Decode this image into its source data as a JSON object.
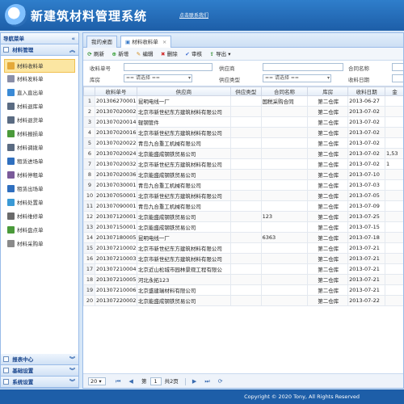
{
  "app": {
    "title": "新建筑材料管理系统",
    "contact_link": "点击联系我们"
  },
  "sidebar": {
    "header": "导航菜单",
    "group_title": "材料管理",
    "items": [
      {
        "label": "材料收料单",
        "icon": "receipt-folder-icon",
        "color": "#e4a93a",
        "active": true
      },
      {
        "label": "材料发料单",
        "icon": "issue-doc-icon",
        "color": "#8a8fa8"
      },
      {
        "label": "直入直出单",
        "icon": "direct-inout-icon",
        "color": "#3a8ad6"
      },
      {
        "label": "材料退库单",
        "icon": "return-icon",
        "color": "#5a6b82"
      },
      {
        "label": "材料退货单",
        "icon": "refund-icon",
        "color": "#5a6b82"
      },
      {
        "label": "材料报损单",
        "icon": "damage-icon",
        "color": "#4a9a3a"
      },
      {
        "label": "材料调拨单",
        "icon": "transfer-icon",
        "color": "#5a6b82"
      },
      {
        "label": "租赁进场单",
        "icon": "lease-in-icon",
        "color": "#2f6fbf"
      },
      {
        "label": "材料停租单",
        "icon": "lease-stop-icon",
        "color": "#7a5a9a"
      },
      {
        "label": "租赁出场单",
        "icon": "lease-out-icon",
        "color": "#2f6fbf"
      },
      {
        "label": "材料处置单",
        "icon": "dispose-icon",
        "color": "#3a9ad6"
      },
      {
        "label": "材料维修单",
        "icon": "repair-icon",
        "color": "#6a6a6a"
      },
      {
        "label": "材料盘点单",
        "icon": "inventory-icon",
        "color": "#4a9a3a"
      },
      {
        "label": "材料采购单",
        "icon": "purchase-icon",
        "color": "#8a8a8a"
      }
    ],
    "bottom_groups": [
      "报表中心",
      "基础设置",
      "系统设置"
    ]
  },
  "tabs": [
    {
      "label": "我的桌面"
    },
    {
      "label": "材料收料单",
      "active": true
    }
  ],
  "toolbar": {
    "refresh": "刷新",
    "add": "新增",
    "edit": "编辑",
    "delete": "删除",
    "audit": "审核",
    "export": "导出"
  },
  "filters": {
    "doc_no_label": "收料单号",
    "supplier_label": "供应商",
    "contract_label": "合同名称",
    "warehouse_label": "库房",
    "warehouse_value": "== 请选择 ==",
    "supplier_type_label": "供应类型",
    "supplier_type_value": "== 请选择 ==",
    "date_label": "收料日期"
  },
  "table": {
    "columns": [
      "收料单号",
      "供应商",
      "供应类型",
      "合同名称",
      "库房",
      "收料日期",
      "金"
    ],
    "rows": [
      {
        "n": "1",
        "no": "201306270001",
        "supplier": "昆明电线一厂",
        "type": "",
        "contract": "国税采购合同",
        "wh": "第二仓库",
        "date": "2013-06-27",
        "amt": ""
      },
      {
        "n": "2",
        "no": "201307020002",
        "supplier": "北京市新世纪东方建筑材料有限公司",
        "type": "",
        "contract": "",
        "wh": "第二仓库",
        "date": "2013-07-02",
        "amt": ""
      },
      {
        "n": "3",
        "no": "201307020014",
        "supplier": "辊钢管件",
        "type": "",
        "contract": "",
        "wh": "第二仓库",
        "date": "2013-07-02",
        "amt": ""
      },
      {
        "n": "4",
        "no": "201307020016",
        "supplier": "北京市新世纪东方建筑材料有限公司",
        "type": "",
        "contract": "",
        "wh": "第二仓库",
        "date": "2013-07-02",
        "amt": ""
      },
      {
        "n": "5",
        "no": "201307020022",
        "supplier": "青岛九合重工机械有限公司",
        "type": "",
        "contract": "",
        "wh": "第二仓库",
        "date": "2013-07-02",
        "amt": ""
      },
      {
        "n": "6",
        "no": "201307020024",
        "supplier": "北京能盛成钢铁贸易公司",
        "type": "",
        "contract": "",
        "wh": "第二仓库",
        "date": "2013-07-02",
        "amt": "1,53"
      },
      {
        "n": "7",
        "no": "201307020032",
        "supplier": "北京市新世纪东方建筑材料有限公司",
        "type": "",
        "contract": "",
        "wh": "第二仓库",
        "date": "2013-07-02",
        "amt": "1"
      },
      {
        "n": "8",
        "no": "201307020036",
        "supplier": "北京能盛成钢铁贸易公司",
        "type": "",
        "contract": "",
        "wh": "第二仓库",
        "date": "2013-07-10",
        "amt": ""
      },
      {
        "n": "9",
        "no": "201307030001",
        "supplier": "青岛九合重工机械有限公司",
        "type": "",
        "contract": "",
        "wh": "第二仓库",
        "date": "2013-07-03",
        "amt": ""
      },
      {
        "n": "10",
        "no": "201307050001",
        "supplier": "北京市新世纪东方建筑材料有限公司",
        "type": "",
        "contract": "",
        "wh": "第二仓库",
        "date": "2013-07-05",
        "amt": ""
      },
      {
        "n": "11",
        "no": "201307090001",
        "supplier": "青岛九合重工机械有限公司",
        "type": "",
        "contract": "",
        "wh": "第二仓库",
        "date": "2013-07-09",
        "amt": ""
      },
      {
        "n": "12",
        "no": "201307120001",
        "supplier": "北京能盛成钢铁贸易公司",
        "type": "",
        "contract": "123",
        "wh": "第二仓库",
        "date": "2013-07-25",
        "amt": ""
      },
      {
        "n": "13",
        "no": "201307150001",
        "supplier": "北京能盛成钢铁贸易公司",
        "type": "",
        "contract": "",
        "wh": "第二仓库",
        "date": "2013-07-15",
        "amt": ""
      },
      {
        "n": "14",
        "no": "201307180005",
        "supplier": "昆明电线一厂",
        "type": "",
        "contract": "6363",
        "wh": "第二仓库",
        "date": "2013-07-18",
        "amt": ""
      },
      {
        "n": "15",
        "no": "201307210002",
        "supplier": "北京市新世纪东方建筑材料有限公司",
        "type": "",
        "contract": "",
        "wh": "第二仓库",
        "date": "2013-07-21",
        "amt": ""
      },
      {
        "n": "16",
        "no": "201307210003",
        "supplier": "北京市新世纪东方建筑材料有限公司",
        "type": "",
        "contract": "",
        "wh": "第二仓库",
        "date": "2013-07-21",
        "amt": ""
      },
      {
        "n": "17",
        "no": "201307210004",
        "supplier": "北京近山松城市园林景观工程有限公",
        "type": "",
        "contract": "",
        "wh": "第二仓库",
        "date": "2013-07-21",
        "amt": ""
      },
      {
        "n": "18",
        "no": "201307210005",
        "supplier": "河北永拓123",
        "type": "",
        "contract": "",
        "wh": "第二仓库",
        "date": "2013-07-21",
        "amt": ""
      },
      {
        "n": "19",
        "no": "201307210006",
        "supplier": "北京盛建瑞材料有限公司",
        "type": "",
        "contract": "",
        "wh": "第二仓库",
        "date": "2013-07-21",
        "amt": ""
      },
      {
        "n": "20",
        "no": "201307220002",
        "supplier": "北京能盛成钢铁贸易公司",
        "type": "",
        "contract": "",
        "wh": "第二仓库",
        "date": "2013-07-22",
        "amt": ""
      }
    ]
  },
  "pager": {
    "page_size": "20",
    "page_prefix": "第",
    "current_page": "1",
    "page_suffix": "共2页"
  },
  "footer": {
    "copyright": "Copyright © 2020 Tony, All Rights Reserved"
  },
  "colors": {
    "header_blue": "#1d5ea8",
    "panel_border": "#99bbe8",
    "active_item": "#fbe6a2"
  }
}
